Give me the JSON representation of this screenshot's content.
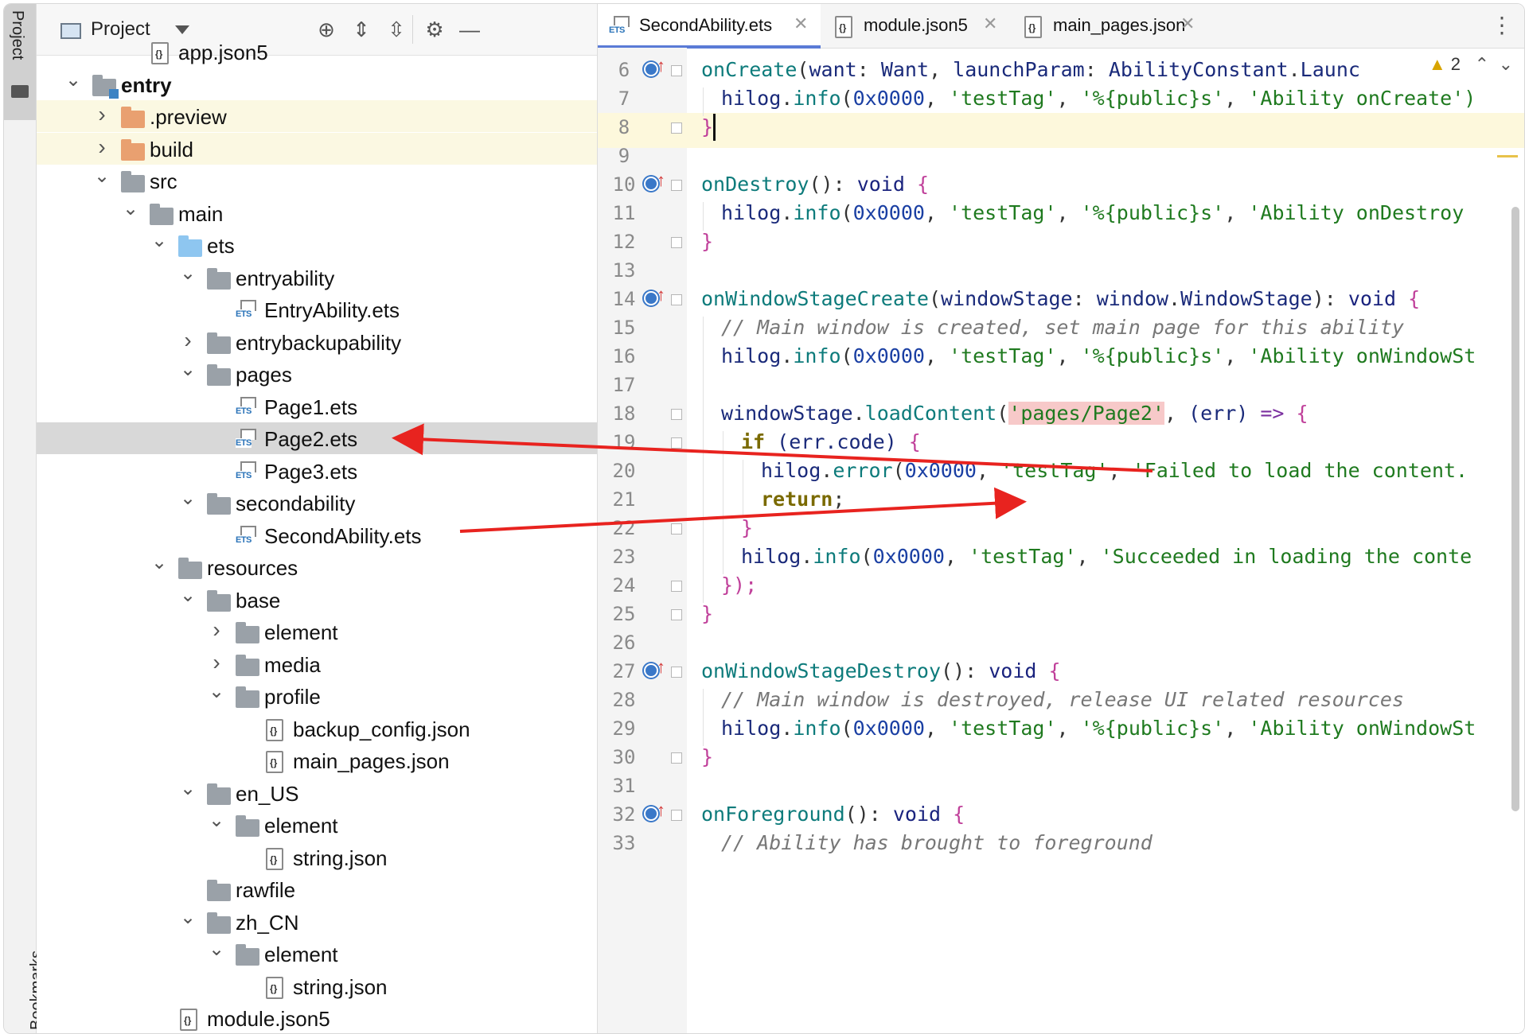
{
  "tool_window": {
    "project_label": "Project",
    "bookmarks_label": "Bookmarks"
  },
  "project_panel": {
    "title": "Project",
    "tree": [
      {
        "label": "app.json5",
        "icon": "json-file-icon"
      },
      {
        "label": "entry",
        "icon": "module-folder-icon",
        "expanded": true
      },
      {
        "label": ".preview",
        "icon": "folder-orange-icon",
        "expanded": false
      },
      {
        "label": "build",
        "icon": "folder-orange-icon",
        "expanded": false
      },
      {
        "label": "src",
        "icon": "folder-icon",
        "expanded": true
      },
      {
        "label": "main",
        "icon": "folder-icon",
        "expanded": true
      },
      {
        "label": "ets",
        "icon": "folder-blue-icon",
        "expanded": true
      },
      {
        "label": "entryability",
        "icon": "folder-icon",
        "expanded": true
      },
      {
        "label": "EntryAbility.ets",
        "icon": "ets-file-icon"
      },
      {
        "label": "entrybackupability",
        "icon": "folder-icon",
        "expanded": false
      },
      {
        "label": "pages",
        "icon": "folder-icon",
        "expanded": true
      },
      {
        "label": "Page1.ets",
        "icon": "ets-file-icon"
      },
      {
        "label": "Page2.ets",
        "icon": "ets-file-icon",
        "selected": true
      },
      {
        "label": "Page3.ets",
        "icon": "ets-file-icon"
      },
      {
        "label": "secondability",
        "icon": "folder-icon",
        "expanded": true
      },
      {
        "label": "SecondAbility.ets",
        "icon": "ets-file-icon"
      },
      {
        "label": "resources",
        "icon": "folder-icon",
        "expanded": true
      },
      {
        "label": "base",
        "icon": "folder-icon",
        "expanded": true
      },
      {
        "label": "element",
        "icon": "folder-icon",
        "expanded": false
      },
      {
        "label": "media",
        "icon": "folder-icon",
        "expanded": false
      },
      {
        "label": "profile",
        "icon": "folder-icon",
        "expanded": true
      },
      {
        "label": "backup_config.json",
        "icon": "json-file-icon"
      },
      {
        "label": "main_pages.json",
        "icon": "json-file-icon"
      },
      {
        "label": "en_US",
        "icon": "folder-icon",
        "expanded": true
      },
      {
        "label": "element",
        "icon": "folder-icon",
        "expanded": true
      },
      {
        "label": "string.json",
        "icon": "json-file-icon"
      },
      {
        "label": "rawfile",
        "icon": "folder-icon"
      },
      {
        "label": "zh_CN",
        "icon": "folder-icon",
        "expanded": true
      },
      {
        "label": "element",
        "icon": "folder-icon",
        "expanded": true
      },
      {
        "label": "string.json",
        "icon": "json-file-icon"
      },
      {
        "label": "module.json5",
        "icon": "json-file-icon"
      }
    ]
  },
  "editor": {
    "tabs": [
      {
        "label": "SecondAbility.ets",
        "icon": "ets-file-icon",
        "active": true
      },
      {
        "label": "module.json5",
        "icon": "json-file-icon"
      },
      {
        "label": "main_pages.json",
        "icon": "json-file-icon"
      }
    ],
    "warnings_count": "2",
    "lines": [
      {
        "n": "6"
      },
      {
        "n": "7"
      },
      {
        "n": "8"
      },
      {
        "n": "9"
      },
      {
        "n": "10"
      },
      {
        "n": "11"
      },
      {
        "n": "12"
      },
      {
        "n": "13"
      },
      {
        "n": "14"
      },
      {
        "n": "15"
      },
      {
        "n": "16"
      },
      {
        "n": "17"
      },
      {
        "n": "18"
      },
      {
        "n": "19"
      },
      {
        "n": "20"
      },
      {
        "n": "21"
      },
      {
        "n": "22"
      },
      {
        "n": "23"
      },
      {
        "n": "24"
      },
      {
        "n": "25"
      },
      {
        "n": "26"
      },
      {
        "n": "27"
      },
      {
        "n": "28"
      },
      {
        "n": "29"
      },
      {
        "n": "30"
      },
      {
        "n": "31"
      },
      {
        "n": "32"
      },
      {
        "n": "33"
      }
    ],
    "code": {
      "l6": {
        "fn": "onCreate",
        "p1": "(",
        "a1": "want",
        "c1": ": ",
        "t1": "Want",
        "c2": ", ",
        "a2": "launchParam",
        "c3": ": ",
        "t2": "AbilityConstant",
        "c4": ".",
        "t3": "Launc"
      },
      "l7": {
        "obj": "hilog",
        "dot": ".",
        "fn": "info",
        "rest1": "(",
        "num": "0x0000",
        "c1": ", ",
        "s1": "'testTag'",
        "c2": ", ",
        "s2": "'%{public}s'",
        "c3": ", ",
        "s3": "'Ability onCreate')"
      },
      "l8": {
        "br": "}"
      },
      "l10": {
        "fn": "onDestroy",
        "p": "(): ",
        "kw": "void",
        "br": " {"
      },
      "l11": {
        "obj": "hilog",
        "dot": ".",
        "fn": "info",
        "rest1": "(",
        "num": "0x0000",
        "c1": ", ",
        "s1": "'testTag'",
        "c2": ", ",
        "s2": "'%{public}s'",
        "c3": ", ",
        "s3": "'Ability onDestroy"
      },
      "l12": {
        "br": "}"
      },
      "l14": {
        "fn": "onWindowStageCreate",
        "p1": "(",
        "a1": "windowStage",
        "c1": ": ",
        "t1": "window",
        "c2": ".",
        "t2": "WindowStage",
        "p2": "): ",
        "kw": "void",
        "br": " {"
      },
      "l15": {
        "cmt": "// Main window is created, set main page for this ability"
      },
      "l16": {
        "obj": "hilog",
        "dot": ".",
        "fn": "info",
        "rest1": "(",
        "num": "0x0000",
        "c1": ", ",
        "s1": "'testTag'",
        "c2": ", ",
        "s2": "'%{public}s'",
        "c3": ", ",
        "s3": "'Ability onWindowSt"
      },
      "l18": {
        "obj": "windowStage",
        "dot": ".",
        "fn": "loadContent",
        "p1": "(",
        "s1": "'pages/Page2'",
        "c1": ", ",
        "a1": "(err)",
        "arr": " => ",
        "br": "{"
      },
      "l19": {
        "kw": "if",
        "rest": " (err.code) ",
        "br": "{"
      },
      "l20": {
        "obj": "hilog",
        "dot": ".",
        "fn": "error",
        "rest1": "(",
        "num": "0x0000",
        "c1": ", ",
        "s1": "'testTag'",
        "c2": ", ",
        "s2": "'Failed to load the content."
      },
      "l21": {
        "kw": "return",
        "p": ";"
      },
      "l22": {
        "br": "}"
      },
      "l23": {
        "obj": "hilog",
        "dot": ".",
        "fn": "info",
        "rest1": "(",
        "num": "0x0000",
        "c1": ", ",
        "s1": "'testTag'",
        "c2": ", ",
        "s2": "'Succeeded in loading the conte"
      },
      "l24": {
        "br": "});"
      },
      "l25": {
        "br": "}"
      },
      "l27": {
        "fn": "onWindowStageDestroy",
        "p": "(): ",
        "kw": "void",
        "br": " {"
      },
      "l28": {
        "cmt": "// Main window is destroyed, release UI related resources"
      },
      "l29": {
        "obj": "hilog",
        "dot": ".",
        "fn": "info",
        "rest1": "(",
        "num": "0x0000",
        "c1": ", ",
        "s1": "'testTag'",
        "c2": ", ",
        "s2": "'%{public}s'",
        "c3": ", ",
        "s3": "'Ability onWindowSt"
      },
      "l30": {
        "br": "}"
      },
      "l32": {
        "fn": "onForeground",
        "p": "(): ",
        "kw": "void",
        "br": " {"
      },
      "l33": {
        "cmt": "// Ability has brought to foreground"
      }
    }
  },
  "annotations": {
    "arrow_color": "#e8231f"
  }
}
